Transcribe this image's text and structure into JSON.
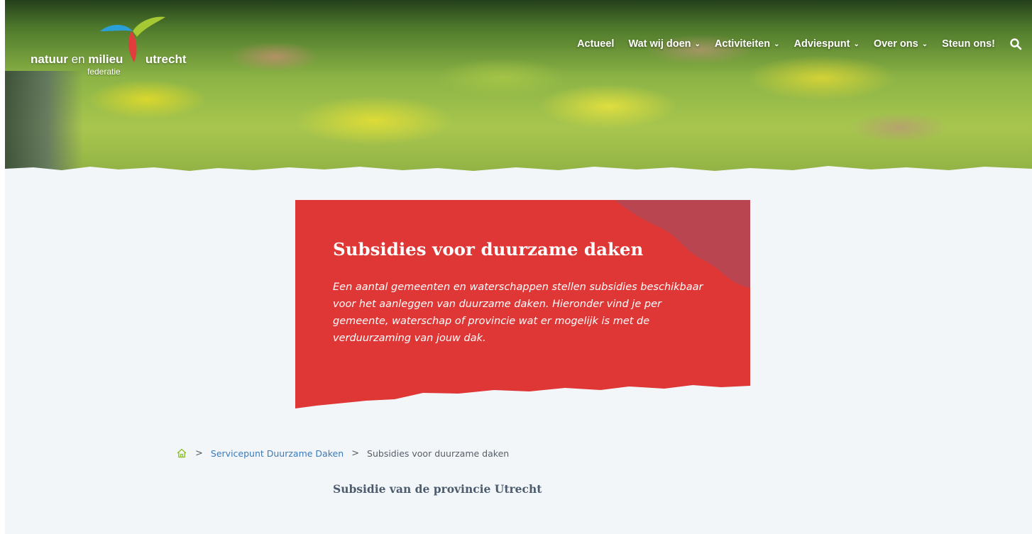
{
  "colors": {
    "accent_red": "#df3636",
    "corner_red": "#b8454f",
    "link_blue": "#3a7ab8",
    "background": "#f3f6f9",
    "heading_slate": "#4c5c6e",
    "home_green": "#8cbf2a"
  },
  "logo": {
    "word1": "natuur",
    "word2": "en",
    "word3": "milieu",
    "word4": "utrecht",
    "subtitle": "federatie",
    "icon": "bird-logo-icon"
  },
  "nav": {
    "items": [
      {
        "label": "Actueel",
        "has_dropdown": false
      },
      {
        "label": "Wat wij doen",
        "has_dropdown": true
      },
      {
        "label": "Activiteiten",
        "has_dropdown": true
      },
      {
        "label": "Adviespunt",
        "has_dropdown": true
      },
      {
        "label": "Over ons",
        "has_dropdown": true
      },
      {
        "label": "Steun ons!",
        "has_dropdown": false
      }
    ],
    "chevron_glyph": "⌄",
    "search_icon": "search-icon"
  },
  "hero_card": {
    "title": "Subsidies voor duurzame daken",
    "intro": "Een aantal gemeenten en waterschappen stellen subsidies beschikbaar voor het aanleggen van duurzame daken. Hieronder vind je per gemeente, waterschap of provincie wat er mogelijk is met de verduurzaming van jouw dak."
  },
  "breadcrumb": {
    "home_icon": "home-icon",
    "separator": ">",
    "items": [
      "Servicepunt Duurzame Daken",
      "Subsidies voor duurzame daken"
    ]
  },
  "content": {
    "section_heading": "Subsidie van de provincie Utrecht"
  }
}
